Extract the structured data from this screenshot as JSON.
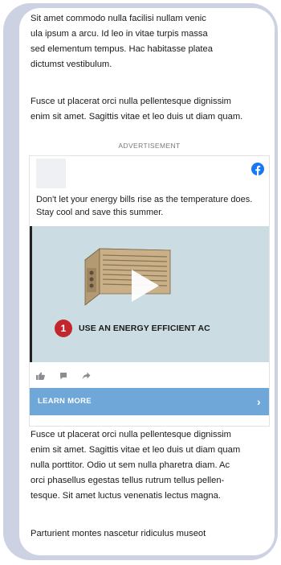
{
  "article": {
    "para_top": "Sit amet commodo nulla facilisi nullam venic\nula ipsum a arcu. Id leo in vitae turpis massa\nsed elementum tempus. Hac habitasse platea\ndictumst vestibulum.",
    "para_2": "Fusce ut placerat orci nulla pellentesque dignissim\nenim sit amet. Sagittis vitae et leo duis ut diam quam.",
    "para_3": "Fusce ut placerat orci nulla pellentesque dignissim\nenim sit amet. Sagittis vitae et leo duis ut diam quam\nnulla porttitor. Odio ut sem nulla pharetra diam. Ac\norci phasellus egestas tellus rutrum tellus pellen-\ntesque. Sit amet luctus venenatis lectus magna.",
    "para_4": "Parturient montes nascetur ridiculus museot"
  },
  "ad": {
    "label": "ADVERTISEMENT",
    "copy": "Don't let your energy bills rise as the temperature does.\nStay cool and save this summer.",
    "video": {
      "step_number": "1",
      "step_text": "USE AN ENERGY EFFICIENT AC"
    },
    "reactions": [
      "like-icon",
      "comment-icon",
      "share-icon"
    ],
    "cta_label": "LEARN MORE",
    "cta_chevron": "›",
    "brand_icon": "facebook-icon"
  },
  "colors": {
    "frame": "#cdd2e3",
    "facebook_blue": "#1877f2",
    "cta_background": "#6fa8d8",
    "video_background": "#cbdde2",
    "step_badge": "#c2272d"
  }
}
